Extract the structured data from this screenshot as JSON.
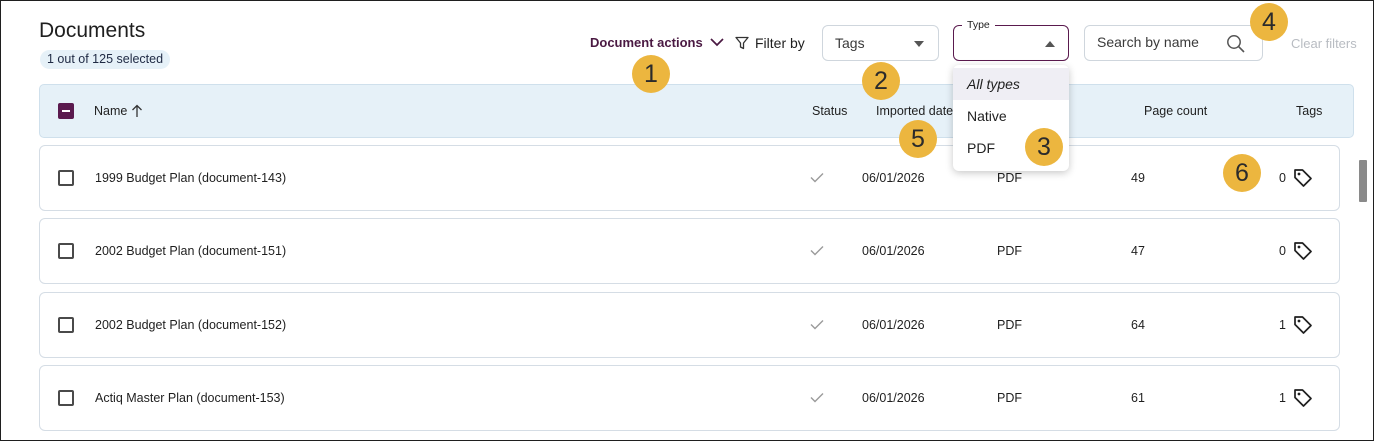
{
  "header": {
    "title": "Documents",
    "selected_text": "1 out of 125 selected",
    "document_actions_label": "Document actions",
    "filter_by_label": "Filter by",
    "tags_select_value": "Tags",
    "type_select_legend": "Type",
    "search_placeholder": "Search by name",
    "clear_filters_label": "Clear filters"
  },
  "type_dropdown": {
    "options": [
      "All types",
      "Native",
      "PDF"
    ],
    "highlighted": "All types"
  },
  "table": {
    "columns": [
      "Name",
      "Status",
      "Imported date",
      "Page count",
      "Tags"
    ],
    "rows": [
      {
        "name": "1999 Budget Plan (document-143)",
        "imported_date": "06/01/2026",
        "type": "PDF",
        "page_count": "49",
        "tags": "0"
      },
      {
        "name": "2002 Budget Plan (document-151)",
        "imported_date": "06/01/2026",
        "type": "PDF",
        "page_count": "47",
        "tags": "0"
      },
      {
        "name": "2002 Budget Plan (document-152)",
        "imported_date": "06/01/2026",
        "type": "PDF",
        "page_count": "64",
        "tags": "1"
      },
      {
        "name": "Actiq Master Plan (document-153)",
        "imported_date": "06/01/2026",
        "type": "PDF",
        "page_count": "61",
        "tags": "1"
      }
    ]
  },
  "callouts": [
    "1",
    "2",
    "3",
    "4",
    "5",
    "6"
  ],
  "colors": {
    "accent": "#5a1a4e",
    "header_bg": "#e6f1f8",
    "callout": "#ecb63f",
    "muted": "#b8bcc2"
  }
}
